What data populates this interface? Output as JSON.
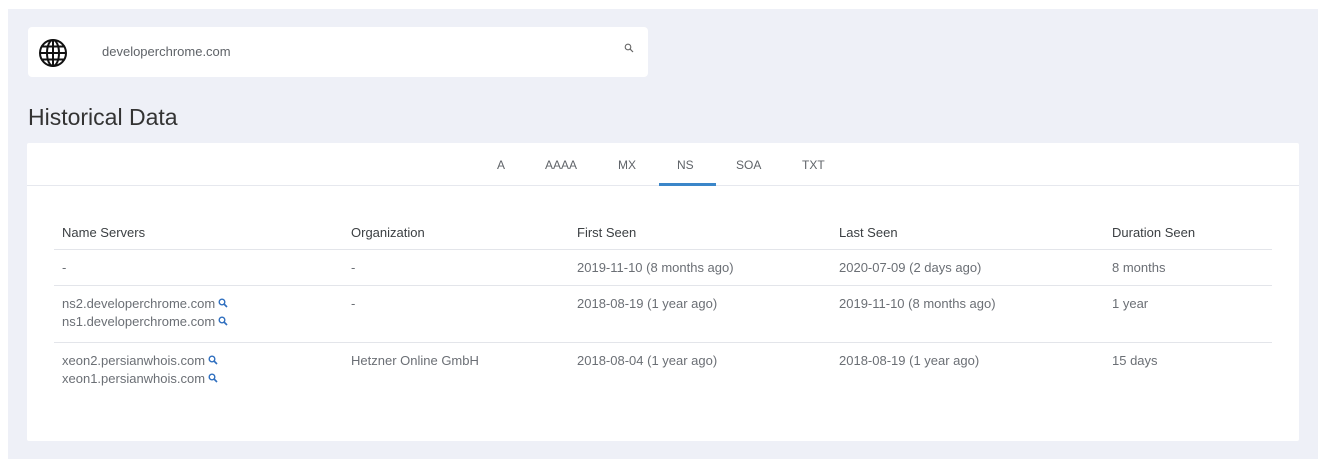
{
  "search": {
    "value": "developerchrome.com",
    "globe_icon": "globe-icon",
    "search_icon": "search-icon"
  },
  "page_title": "Historical Data",
  "tabs": [
    {
      "label": "A"
    },
    {
      "label": "AAAA"
    },
    {
      "label": "MX"
    },
    {
      "label": "NS",
      "active": true
    },
    {
      "label": "SOA"
    },
    {
      "label": "TXT"
    }
  ],
  "table": {
    "headers": [
      "Name Servers",
      "Organization",
      "First Seen",
      "Last Seen",
      "Duration Seen"
    ],
    "rows": [
      {
        "name_servers": [
          "-"
        ],
        "organization": "-",
        "first_seen": "2019-11-10 (8 months ago)",
        "last_seen": "2020-07-09 (2 days ago)",
        "duration": "8 months"
      },
      {
        "name_servers": [
          "ns2.developerchrome.com",
          "ns1.developerchrome.com"
        ],
        "organization": "-",
        "first_seen": "2018-08-19 (1 year ago)",
        "last_seen": "2019-11-10 (8 months ago)",
        "duration": "1 year"
      },
      {
        "name_servers": [
          "xeon2.persianwhois.com",
          "xeon1.persianwhois.com"
        ],
        "organization": "Hetzner Online GmbH",
        "first_seen": "2018-08-04 (1 year ago)",
        "last_seen": "2018-08-19 (1 year ago)",
        "duration": "15 days"
      }
    ]
  },
  "colors": {
    "background": "#eef0f7",
    "accent": "#3b86c9",
    "link_icon": "#2f6fbf"
  }
}
